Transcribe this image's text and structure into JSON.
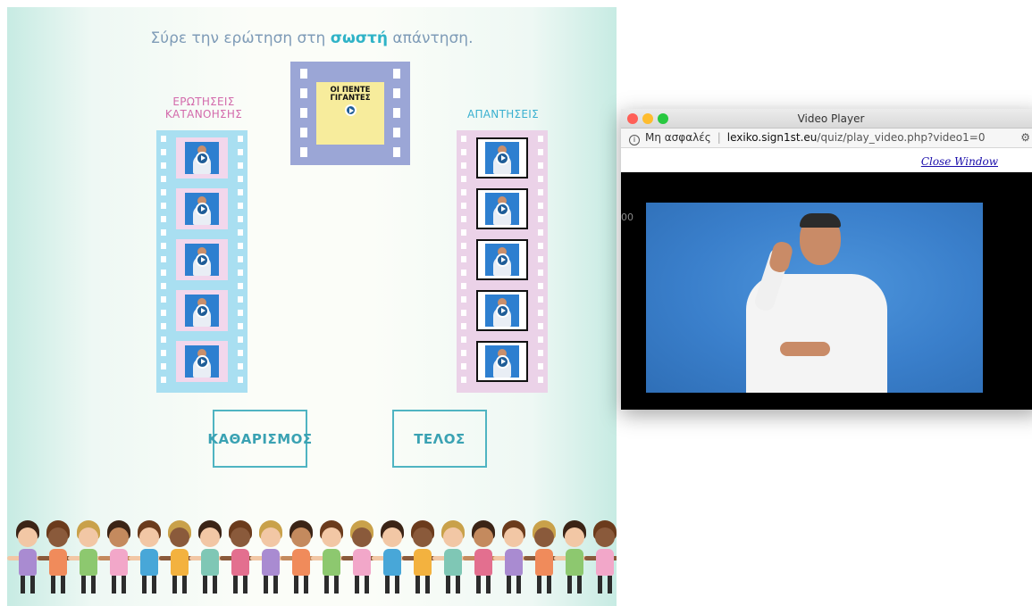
{
  "quiz": {
    "instruction_before": "Σύρε την ερώτηση στη",
    "instruction_bold": "σωστή",
    "instruction_after": "απάντηση.",
    "questions_title": "ΕΡΩΤΗΣΕΙΣ ΚΑΤΑΝΟΗΣΗΣ",
    "answers_title": "ΑΠΑΝΤΗΣΕΙΣ",
    "main_card_line1": "ΟΙ ΠΕΝΤΕ",
    "main_card_line2": "ΓΙΓΑΝΤΕΣ",
    "question_count": 5,
    "answer_count": 5,
    "clear_label": "ΚΑΘΑΡΙΣΜΟΣ",
    "end_label": "ΤΕΛΟΣ"
  },
  "popup": {
    "title": "Video Player",
    "security": "Μη ασφαλές",
    "url_domain": "lexiko.sign1st.eu",
    "url_path": "/quiz/play_video.php?video1=0",
    "close_link": "Close Window",
    "time_fragment": "00"
  },
  "colors": {
    "questions_strip": "#a9dff1",
    "answers_strip": "#ebd2e8",
    "main_film": "#9ba6d6",
    "main_card": "#f7ec9c",
    "button_border": "#4fb4c2",
    "video_bg": "#3a7fcb"
  }
}
